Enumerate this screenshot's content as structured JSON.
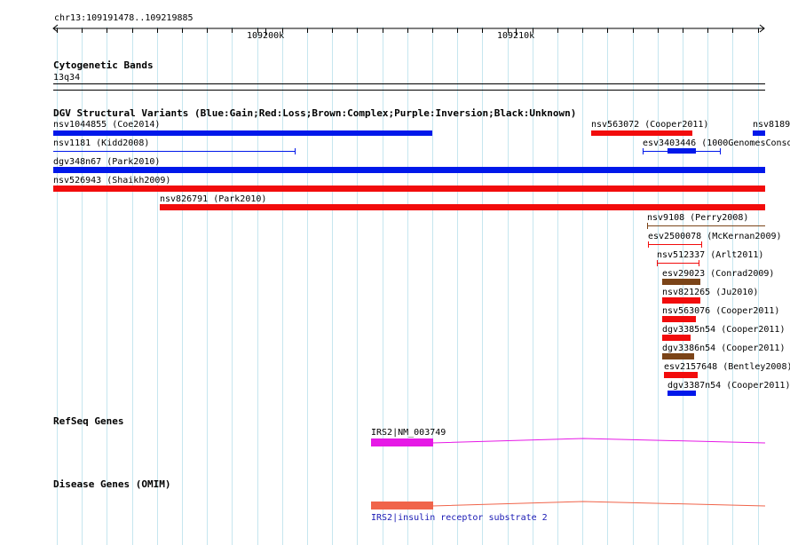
{
  "ruler": {
    "location": "chr13:109191478..109219885",
    "ticks": [
      "109200k",
      "109210k"
    ]
  },
  "cytoband": {
    "title": "Cytogenetic Bands",
    "band": "13q34"
  },
  "dgv": {
    "title": "DGV Structural Variants (Blue:Gain;Red:Loss;Brown:Complex;Purple:Inversion;Black:Unknown)",
    "colors": {
      "gain": "#0018ea",
      "loss": "#f20c0c",
      "complex": "#7b4418"
    },
    "variants": [
      {
        "label": "nsv1044855 (Coe2014)",
        "type": "gain"
      },
      {
        "label": "nsv563072 (Cooper2011)",
        "type": "loss"
      },
      {
        "label": "nsv8189",
        "type": "gain"
      },
      {
        "label": "nsv1181 (Kidd2008)",
        "type": "gain"
      },
      {
        "label": "esv3403446 (1000GenomesConso",
        "type": "gain"
      },
      {
        "label": "dgv348n67 (Park2010)",
        "type": "gain"
      },
      {
        "label": "nsv526943 (Shaikh2009)",
        "type": "loss"
      },
      {
        "label": "nsv826791 (Park2010)",
        "type": "loss"
      },
      {
        "label": "nsv9108 (Perry2008)",
        "type": "complex"
      },
      {
        "label": "esv2500078 (McKernan2009)",
        "type": "loss"
      },
      {
        "label": "nsv512337 (Arlt2011)",
        "type": "loss"
      },
      {
        "label": "esv29023 (Conrad2009)",
        "type": "complex"
      },
      {
        "label": "nsv821265 (Ju2010)",
        "type": "loss"
      },
      {
        "label": "nsv563076 (Cooper2011)",
        "type": "loss"
      },
      {
        "label": "dgv3385n54 (Cooper2011)",
        "type": "loss"
      },
      {
        "label": "dgv3386n54 (Cooper2011)",
        "type": "complex"
      },
      {
        "label": "esv2157648 (Bentley2008)",
        "type": "loss"
      },
      {
        "label": "dgv3387n54 (Cooper2011)",
        "type": "gain"
      }
    ]
  },
  "refseq": {
    "title": "RefSeq Genes",
    "gene": "IRS2|NM_003749",
    "color": "#e619e6"
  },
  "omim": {
    "title": "Disease Genes (OMIM)",
    "gene": "IRS2|insulin receptor substrate 2",
    "color": "#f0644a",
    "label_color": "#1a1ab4"
  }
}
